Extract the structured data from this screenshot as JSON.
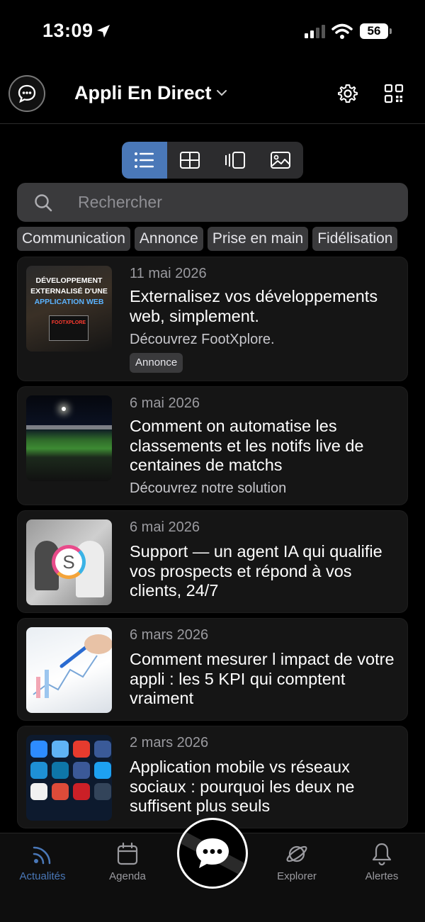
{
  "status_bar": {
    "time": "13:09",
    "battery": "56"
  },
  "header": {
    "title": "Appli En Direct"
  },
  "views": [
    "list-view",
    "grid-view",
    "carousel-view",
    "gallery-view"
  ],
  "search": {
    "placeholder": "Rechercher"
  },
  "categories": [
    "Communication",
    "Annonce",
    "Prise en main",
    "Fidélisation"
  ],
  "articles": [
    {
      "date": "11 mai 2026",
      "title": "Externalisez vos développements web, simplement.",
      "subtitle": "Découvrez FootXplore.",
      "tag": "Annonce",
      "thumb_text": {
        "line1": "DÉVELOPPEMENT",
        "line2": "EXTERNALISÉ D'UNE",
        "line3": "APPLICATION WEB",
        "brand": "FOOTXPLORE"
      }
    },
    {
      "date": "6 mai 2026",
      "title": "Comment on automatise les classements et les notifs live de centaines de matchs",
      "subtitle": "Découvrez notre solution"
    },
    {
      "date": "6 mai 2026",
      "title": "Support — un agent IA qui qualifie vos prospects et répond à vos clients, 24/7"
    },
    {
      "date": "6 mars 2026",
      "title": "Comment mesurer l impact de votre appli : les 5 KPI qui comptent vraiment"
    },
    {
      "date": "2 mars 2026",
      "title": "Application mobile vs réseaux sociaux : pourquoi les deux ne suffisent plus seuls"
    }
  ],
  "tabs": [
    {
      "label": "Actualités",
      "icon": "rss-icon"
    },
    {
      "label": "Agenda",
      "icon": "calendar-icon"
    },
    {
      "label": "Explorer",
      "icon": "planet-icon"
    },
    {
      "label": "Alertes",
      "icon": "bell-icon"
    }
  ],
  "colors": {
    "accent": "#4a78b8",
    "background": "#000000",
    "card": "#151515"
  }
}
